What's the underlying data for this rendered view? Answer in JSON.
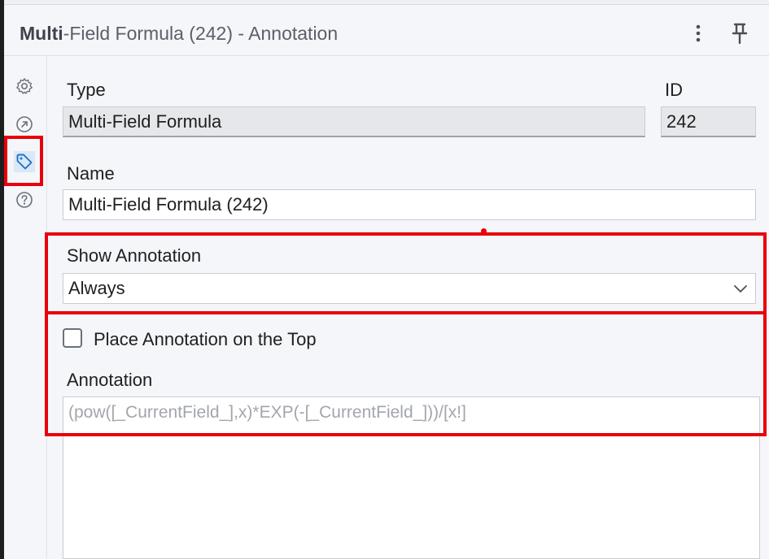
{
  "header": {
    "title_bold": "Multi",
    "title_rest": "-Field Formula (242) - Annotation",
    "icons": [
      "kebab-menu-icon",
      "pin-icon"
    ]
  },
  "rail": {
    "items": [
      {
        "icon": "gear-icon",
        "active": false
      },
      {
        "icon": "connection-icon",
        "active": false
      },
      {
        "icon": "tag-icon",
        "active": true
      },
      {
        "icon": "help-icon",
        "active": false
      }
    ]
  },
  "form": {
    "type_label": "Type",
    "type_value": "Multi-Field Formula",
    "id_label": "ID",
    "id_value": "242",
    "name_label": "Name",
    "name_value": "Multi-Field Formula (242)",
    "show_annotation_label": "Show Annotation",
    "show_annotation_value": "Always",
    "place_top_label": "Place Annotation on the Top",
    "place_top_checked": false,
    "annotation_label": "Annotation",
    "annotation_placeholder": "(pow([_CurrentField_],x)*EXP(-[_CurrentField_]))/[x!]"
  },
  "colors": {
    "highlight": "#e8000b",
    "panel_bg": "#f4f6f9",
    "active_icon": "#1a73c9"
  }
}
